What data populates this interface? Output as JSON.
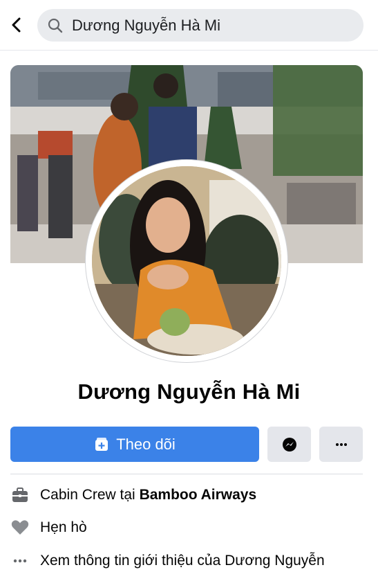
{
  "search": {
    "query": "Dương Nguyễn Hà Mi"
  },
  "profile": {
    "name": "Dương Nguyễn Hà Mi",
    "cover_icon": "cover-photo",
    "avatar_icon": "profile-photo"
  },
  "actions": {
    "follow_label": "Theo dõi",
    "messenger_icon": "messenger-icon",
    "more_icon": "more-icon"
  },
  "about": {
    "work_prefix": "Cabin Crew tại ",
    "work_company": "Bamboo Airways",
    "relationship": "Hẹn hò",
    "see_about": "Xem thông tin giới thiệu của Dương Nguyễn"
  },
  "colors": {
    "primary": "#3b82e8",
    "button_gray": "#e4e6eb",
    "icon_gray": "#65676b"
  }
}
